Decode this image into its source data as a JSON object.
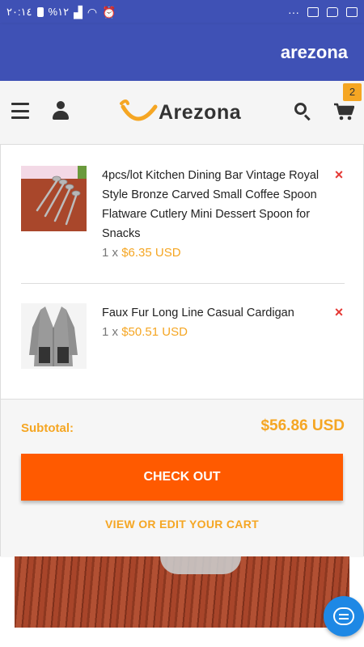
{
  "status_bar": {
    "time": "٢٠:١٤",
    "battery": "%١٢"
  },
  "app_bar": {
    "title": "arezona"
  },
  "header": {
    "logo_text": "Arezona",
    "cart_count": "2"
  },
  "cart": {
    "items": [
      {
        "name": "4pcs/lot Kitchen Dining Bar Vintage Royal Style Bronze Carved Small Coffee Spoon Flatware Cutlery Mini Dessert Spoon for Snacks",
        "qty_prefix": "1 x ",
        "price": "$6.35 USD",
        "remove": "×"
      },
      {
        "name": "Faux Fur Long Line Casual Cardigan",
        "qty_prefix": "1 x ",
        "price": "$50.51 USD",
        "remove": "×"
      }
    ],
    "subtotal_label": "Subtotal:",
    "subtotal_value": "$56.86 USD",
    "checkout_label": "CHECK OUT",
    "view_cart_label": "VIEW OR EDIT YOUR CART"
  },
  "colors": {
    "app_bar": "#3f51b5",
    "accent": "#f5a623",
    "checkout": "#ff5a00",
    "remove": "#e53935",
    "chat_fab": "#1e88e5"
  },
  "icons": [
    "menu-icon",
    "user-icon",
    "search-icon",
    "cart-icon",
    "remove-icon",
    "chat-icon"
  ]
}
